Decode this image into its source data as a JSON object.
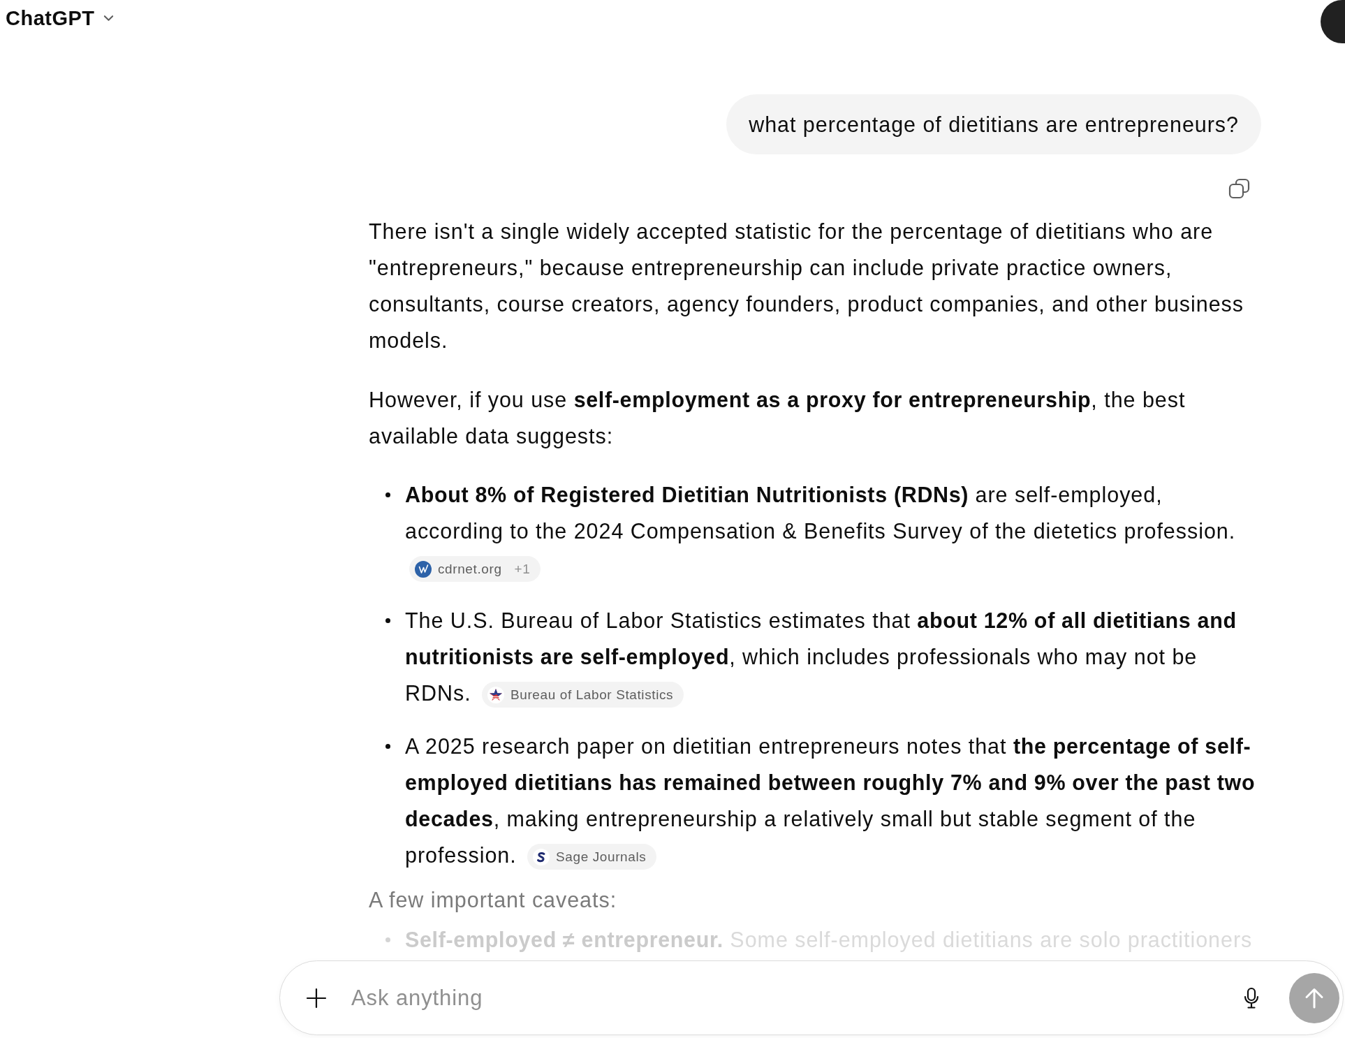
{
  "header": {
    "title": "ChatGPT"
  },
  "conversation": {
    "user_message": "what percentage of dietitians are entrepreneurs?",
    "assistant": {
      "paragraphs": [
        "There isn't a single widely accepted statistic for the percentage of dietitians who are \"entrepreneurs,\" because entrepreneurship can include private practice owners, consultants, course creators, agency founders, product companies, and other business models.",
        "However, if you use **self-employment as a proxy for entrepreneurship**, the best available data suggests:"
      ],
      "bullets": [
        {
          "text": "**About 8% of Registered Dietitian Nutritionists (RDNs)** are self-employed, according to the 2024 Compensation & Benefits Survey of the dietetics profession.",
          "citations": [
            {
              "kind": "w",
              "source": "cdrnet.org",
              "extra": "+1"
            }
          ]
        },
        {
          "text": "The U.S. Bureau of Labor Statistics estimates that **about 12% of all dietitians and nutritionists are self-employed**, which includes professionals who may not be RDNs.",
          "citations": [
            {
              "kind": "star",
              "source": "Bureau of Labor Statistics"
            }
          ]
        },
        {
          "text": "A 2025 research paper on dietitian entrepreneurs notes that **the percentage of self-employed dietitians has remained between roughly 7% and 9% over the past two decades**, making entrepreneurship a relatively small but stable segment of the profession.",
          "citations": [
            {
              "kind": "s",
              "source": "Sage Journals"
            }
          ]
        }
      ],
      "caveats": {
        "heading": "A few important caveats:",
        "items": [
          "**Self-employed ≠ entrepreneur.** Some self-employed dietitians are solo practitioners"
        ]
      }
    }
  },
  "composer": {
    "placeholder": "Ask anything",
    "send_button": {
      "disabled": true
    }
  }
}
